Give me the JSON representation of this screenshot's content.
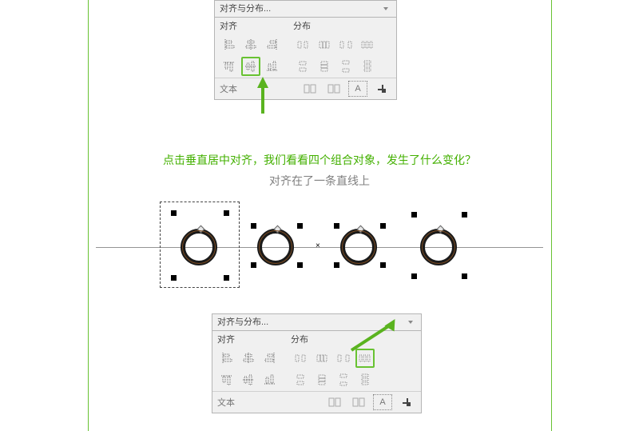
{
  "panel_title": "对齐与分布...",
  "group_align": "对齐",
  "group_dist": "分布",
  "footer_text": "文本",
  "panel1": {
    "highlight": "align-horizontal-center"
  },
  "panel2": {
    "highlight": "distribute-horizontal-spacing"
  },
  "caption_green": "点击垂直居中对齐，我们看看四个组合对象，发生了什么变化？",
  "caption_gray": "对齐在了一条直线上",
  "icons": {
    "align": {
      "r1": [
        "align-left",
        "align-center-h",
        "align-right"
      ],
      "r2": [
        "align-top",
        "align-center-v",
        "align-bottom"
      ]
    },
    "dist": {
      "r1": [
        "dist-left",
        "dist-center-h",
        "dist-right",
        "dist-spacing-h"
      ],
      "r2": [
        "dist-top",
        "dist-center-v",
        "dist-bottom",
        "dist-spacing-v"
      ]
    },
    "footer": [
      "footer-outline-a",
      "footer-outline-b",
      "footer-text-A",
      "footer-corner"
    ]
  }
}
